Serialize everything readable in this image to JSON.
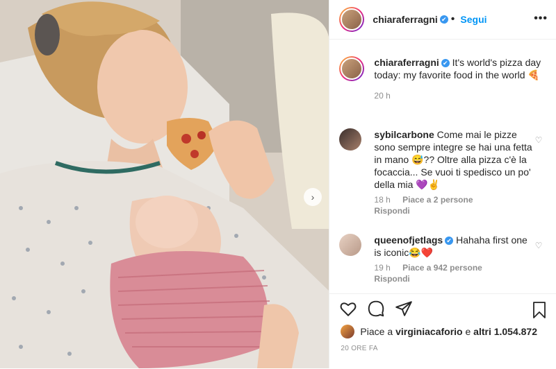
{
  "header": {
    "username": "chiaraferragni",
    "verified_mark": "✔",
    "follow_label": "Segui",
    "more_label": "•••"
  },
  "caption": {
    "username": "chiaraferragni",
    "text": "It's world's pizza day today: my favorite food in the world 🍕",
    "time": "20 h"
  },
  "comments": [
    {
      "username": "sybilcarbone",
      "text": "Come mai le pizze sono sempre integre se hai una fetta in mano 😅?? Oltre alla pizza c'è la focaccia... Se vuoi ti spedisco un po' della mia 💜✌️",
      "time": "18 h",
      "likes": "Piace a 2 persone",
      "reply": "Rispondi"
    },
    {
      "username": "queenofjetlags",
      "text": "Hahaha first one is iconic😂❤️",
      "time": "19 h",
      "likes": "Piace a 942 persone",
      "reply": "Rispondi"
    }
  ],
  "likes_bar": {
    "prefix": "Piace a ",
    "user": "virginiacaforio",
    "middle": " e ",
    "others": "altri 1.054.872"
  },
  "timestamp": "20 ORE FA",
  "colors": {
    "accent": "#0095f6",
    "verified": "#3897f0",
    "muted": "#8e8e8e"
  }
}
